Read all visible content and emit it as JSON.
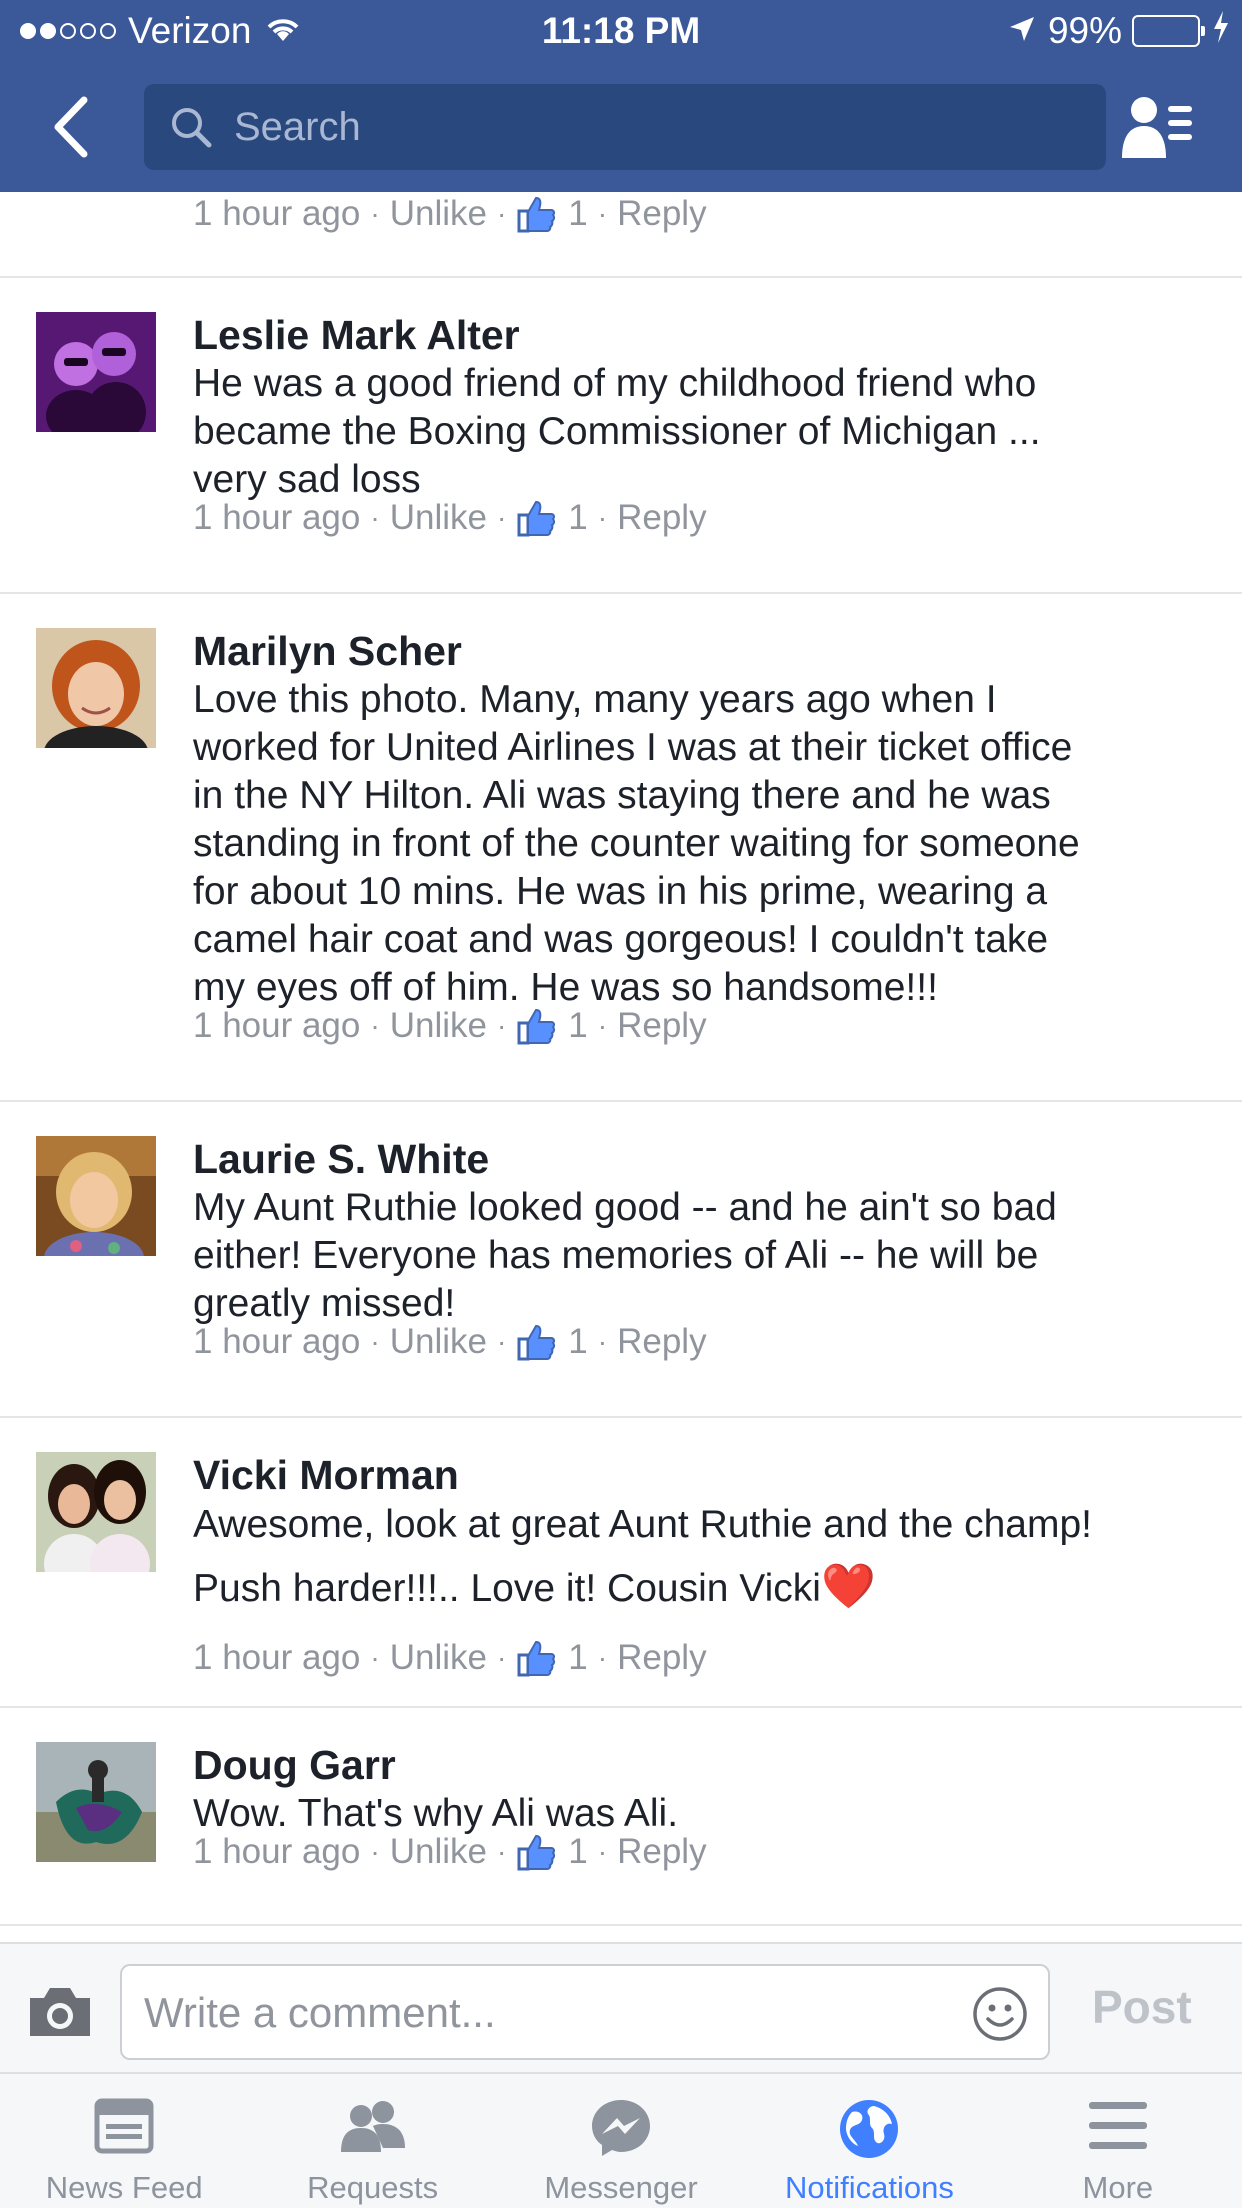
{
  "status_bar": {
    "carrier": "Verizon",
    "time": "11:18 PM",
    "battery": "99%",
    "battery_level": 0.99
  },
  "nav": {
    "search_placeholder": "Search"
  },
  "top_partial_meta": {
    "time": "1 hour ago",
    "unlike": "Unlike",
    "likes": "1",
    "reply": "Reply"
  },
  "comments": [
    {
      "name": "Leslie Mark Alter",
      "lines": [
        "He was a good friend of my childhood friend who",
        "became the Boxing Commissioner of Michigan ...",
        "very sad loss"
      ],
      "time": "1 hour ago",
      "unlike": "Unlike",
      "likes": "1",
      "reply": "Reply"
    },
    {
      "name": "Marilyn Scher",
      "lines": [
        "Love this photo. Many, many years ago when I",
        "worked for United Airlines I was at their ticket office",
        "in the NY Hilton. Ali was staying there and he was",
        "standing in front of the counter waiting for someone",
        "for about 10 mins. He was in his prime, wearing a",
        "camel hair coat and was gorgeous! I couldn't take",
        "my eyes off of him. He was so handsome!!!"
      ],
      "time": "1 hour ago",
      "unlike": "Unlike",
      "likes": "1",
      "reply": "Reply"
    },
    {
      "name": "Laurie S. White",
      "lines": [
        "My Aunt Ruthie looked good -- and he ain't so bad",
        "either!  Everyone has memories of Ali -- he will be",
        "greatly missed!"
      ],
      "time": "1 hour ago",
      "unlike": "Unlike",
      "likes": "1",
      "reply": "Reply"
    },
    {
      "name": "Vicki Morman",
      "lines": [
        "Awesome, look at great Aunt Ruthie and the champ!",
        "Push harder!!!.. Love it!  Cousin Vicki"
      ],
      "emoji": "❤️",
      "time": "1 hour ago",
      "unlike": "Unlike",
      "likes": "1",
      "reply": "Reply"
    },
    {
      "name": "Doug Garr",
      "lines": [
        "Wow. That's why Ali was Ali."
      ],
      "time": "1 hour ago",
      "unlike": "Unlike",
      "likes": "1",
      "reply": "Reply"
    }
  ],
  "composer": {
    "placeholder": "Write a comment...",
    "post_label": "Post"
  },
  "tabs": [
    {
      "label": "News Feed",
      "icon": "news-feed-icon"
    },
    {
      "label": "Requests",
      "icon": "requests-icon"
    },
    {
      "label": "Messenger",
      "icon": "messenger-icon"
    },
    {
      "label": "Notifications",
      "icon": "globe-icon",
      "active": true
    },
    {
      "label": "More",
      "icon": "menu-icon"
    }
  ],
  "colors": {
    "brand": "#3b5998",
    "search_bg": "#29487d",
    "active_tab": "#4080ff",
    "meta_gray": "#90949c",
    "like_blue": "#4267b2"
  }
}
